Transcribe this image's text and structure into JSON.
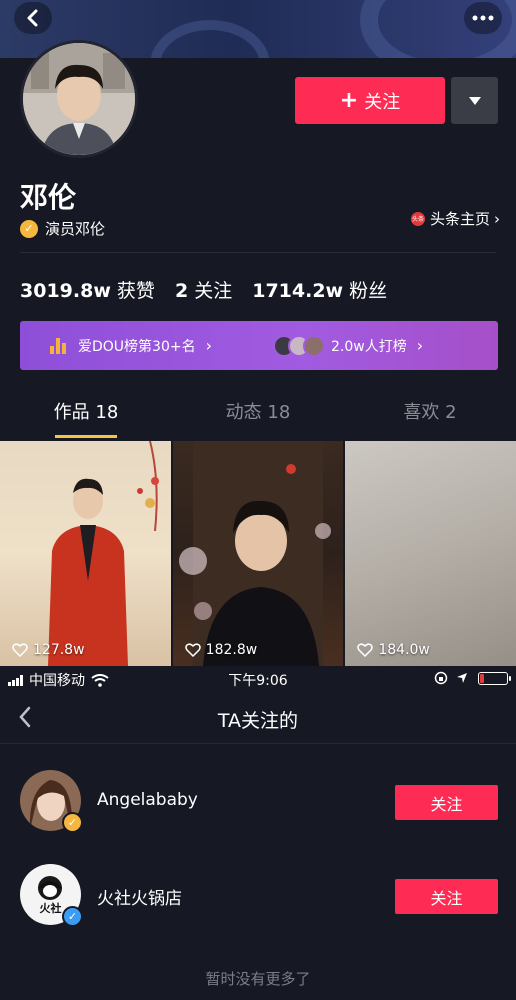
{
  "profile": {
    "name": "邓伦",
    "verified_label": "演员邓伦",
    "toutiao_badge": "头条",
    "toutiao_link": "头条主页",
    "follow_button": "关注",
    "stats": [
      {
        "value": "3019.8w",
        "label": "获赞"
      },
      {
        "value": "2",
        "label": "关注"
      },
      {
        "value": "1714.2w",
        "label": "粉丝"
      }
    ],
    "banner": {
      "rank_text": "爱DOU榜第30+名",
      "support_text": "2.0w人打榜"
    },
    "tabs": [
      {
        "label": "作品 18"
      },
      {
        "label": "动态 18"
      },
      {
        "label": "喜欢 2"
      }
    ],
    "videos": [
      {
        "likes": "127.8w"
      },
      {
        "likes": "182.8w"
      },
      {
        "likes": "184.0w"
      }
    ]
  },
  "status_bar": {
    "carrier": "中国移动",
    "time": "下午9:06"
  },
  "following": {
    "title": "TA关注的",
    "users": [
      {
        "name": "Angelababy",
        "button": "关注",
        "badge_color": "#f5b73d"
      },
      {
        "name": "火社火锅店",
        "button": "关注",
        "badge_color": "#3b9cf5"
      }
    ],
    "avatar_text": "火社",
    "footer": "暂时没有更多了"
  },
  "colors": {
    "accent": "#fe2c55",
    "background": "#161823",
    "tab_indicator": "#f5c443",
    "banner_purple": "#a15be0"
  }
}
